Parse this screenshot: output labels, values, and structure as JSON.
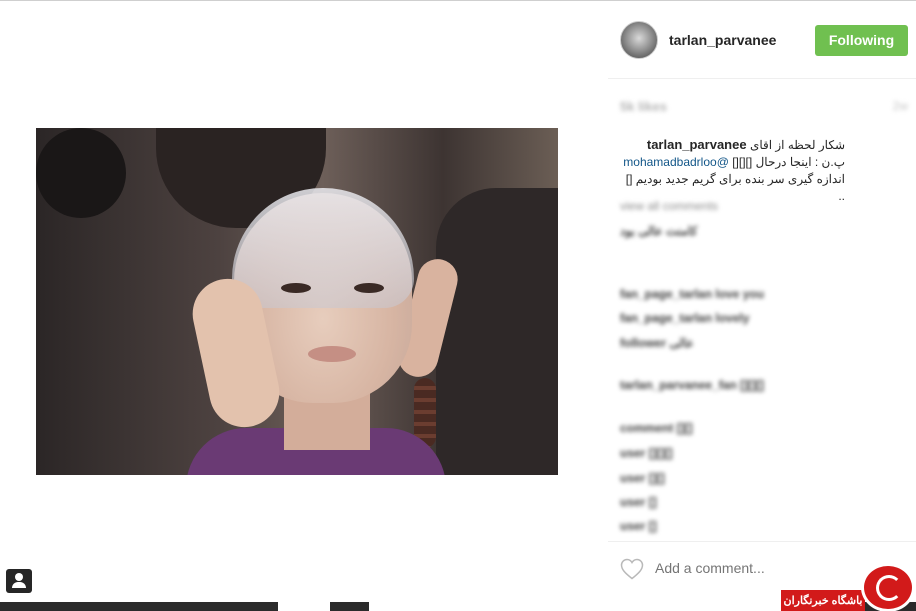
{
  "post": {
    "username": "tarlan_parvanee",
    "follow_label": "Following",
    "likes": "5k likes",
    "age": "2w",
    "caption_user": "tarlan_parvanee",
    "caption_line1": "شکار لحظه از اقای",
    "caption_line2_prefix": "پ.ن : اینجا درحال",
    "caption_line2_boxes": "[][][]",
    "caption_mention": "@mohamadbadrloo",
    "caption_line3": "اندازه گیری سر بنده برای گریم جدید بودیم",
    "caption_line3_suffix": "[] ..",
    "comments": [
      {
        "user": "view all comments",
        "text": ""
      },
      {
        "user": "کامنت",
        "text": "عالی بود"
      },
      {
        "user": "fan_page_tarlan",
        "text": "love you"
      },
      {
        "user": "fan_page_tarlan",
        "text": "lovely"
      },
      {
        "user": "follower",
        "text": "عالی"
      },
      {
        "user": "tarlan_parvanee_fan",
        "text": "[][][]"
      },
      {
        "user": "comment",
        "text": "[][]"
      },
      {
        "user": "user",
        "text": "[][][]"
      },
      {
        "user": "user",
        "text": "[][]"
      },
      {
        "user": "user",
        "text": "[]"
      },
      {
        "user": "user",
        "text": "[]"
      }
    ],
    "add_comment_placeholder": "Add a comment..."
  },
  "icons": {
    "heart": "heart-icon",
    "profile": "profile-icon",
    "watermark": "watermark-logo"
  },
  "watermark_text": "باشگاه خبرنگاران",
  "colors": {
    "follow_bg": "#70c050",
    "mention": "#125688",
    "watermark": "#d21a1a"
  }
}
